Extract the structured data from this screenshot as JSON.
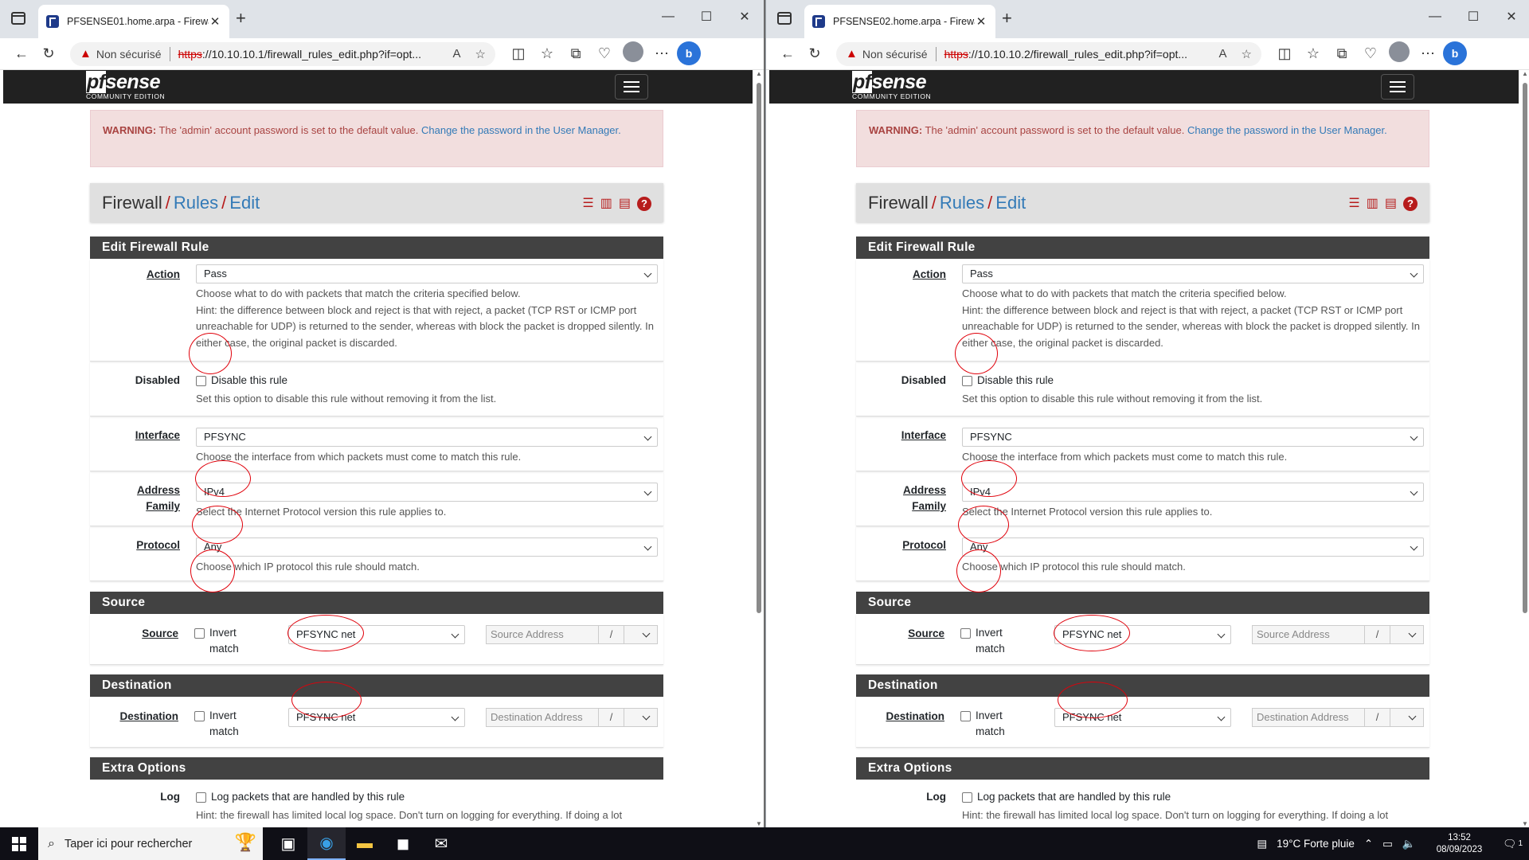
{
  "browsers": [
    {
      "tab_title": "PFSENSE01.home.arpa - Firewall: ...",
      "address_not_secure": "Non sécurisé",
      "url_scheme": "https",
      "url_rest": "://10.10.10.1/firewall_rules_edit.php?if=opt..."
    },
    {
      "tab_title": "PFSENSE02.home.arpa - Firewall: ...",
      "address_not_secure": "Non sécurisé",
      "url_scheme": "https",
      "url_rest": "://10.10.10.2/firewall_rules_edit.php?if=opt..."
    }
  ],
  "page": {
    "logo_main": "sense",
    "logo_prefix": "pf",
    "logo_sub": "COMMUNITY EDITION",
    "alert": {
      "strong": "WARNING:",
      "text": " The 'admin' account password is set to the default value. ",
      "link": "Change the password in the User Manager."
    },
    "breadcrumb": {
      "c1": "Firewall",
      "c2": "Rules",
      "c3": "Edit"
    },
    "edit_title": "Edit Firewall Rule",
    "action": {
      "label": "Action",
      "value": "Pass",
      "help1": "Choose what to do with packets that match the criteria specified below.",
      "help2": "Hint: the difference between block and reject is that with reject, a packet (TCP RST or ICMP port unreachable for UDP) is returned to the sender, whereas with block the packet is dropped silently. In either case, the original packet is discarded."
    },
    "disabled": {
      "label": "Disabled",
      "checkbox": "Disable this rule",
      "help": "Set this option to disable this rule without removing it from the list."
    },
    "interface": {
      "label": "Interface",
      "value": "PFSYNC",
      "help": "Choose the interface from which packets must come to match this rule."
    },
    "address_family": {
      "label1": "Address",
      "label2": "Family",
      "value": "IPv4",
      "help": "Select the Internet Protocol version this rule applies to."
    },
    "protocol": {
      "label": "Protocol",
      "value": "Any",
      "help": "Choose which IP protocol this rule should match."
    },
    "source": {
      "title": "Source",
      "label": "Source",
      "invert1": "Invert",
      "invert2": "match",
      "value": "PFSYNC net",
      "placeholder": "Source Address",
      "slash": "/"
    },
    "destination": {
      "title": "Destination",
      "label": "Destination",
      "invert1": "Invert",
      "invert2": "match",
      "value": "PFSYNC net",
      "placeholder": "Destination Address",
      "slash": "/"
    },
    "extra": {
      "title": "Extra Options",
      "log_label": "Log",
      "log_checkbox": "Log packets that are handled by this rule",
      "log_help": "Hint: the firewall has limited local log space. Don't turn on logging for everything. If doing a lot"
    }
  },
  "taskbar": {
    "search_placeholder": "Taper ici pour rechercher",
    "weather": "19°C  Forte pluie",
    "time": "13:52",
    "date": "08/09/2023",
    "notifications": "1"
  }
}
